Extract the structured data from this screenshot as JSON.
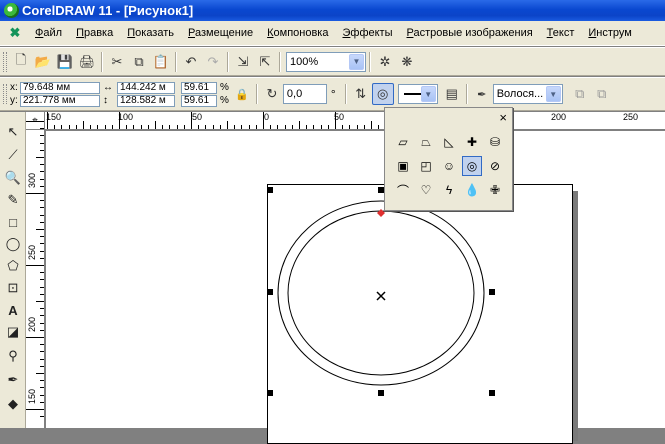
{
  "title": "CorelDRAW 11 - [Рисунок1]",
  "menu": [
    "Файл",
    "Правка",
    "Показать",
    "Размещение",
    "Компоновка",
    "Эффекты",
    "Растровые изображения",
    "Текст",
    "Инструм"
  ],
  "toolbar": {
    "zoom": "100%"
  },
  "props": {
    "x_label": "x:",
    "y_label": "y:",
    "x": "79.648 мм",
    "y": "221.778 мм",
    "width": "144.242 м",
    "height": "128.582 м",
    "scale_x": "59.61",
    "scale_y": "59.61",
    "pct1": "%",
    "pct2": "%",
    "rotation": "0,0",
    "deg": "°",
    "outline": "Волося..."
  },
  "ruler": {
    "h": [
      "150",
      "100",
      "50",
      "0",
      "50",
      "100",
      "150",
      "200",
      "250"
    ],
    "v": [
      "300",
      "250",
      "200",
      "150"
    ]
  },
  "popup": {
    "close": "×"
  },
  "icons": [
    "selection-icon",
    "shape-icon",
    "zoom-icon",
    "freehand-icon",
    "rectangle-icon",
    "ellipse-icon",
    "polygon-icon",
    "basic-shapes-icon",
    "text-icon",
    "interactive-icon",
    "eyedropper-icon",
    "outline-icon",
    "fill-icon"
  ]
}
